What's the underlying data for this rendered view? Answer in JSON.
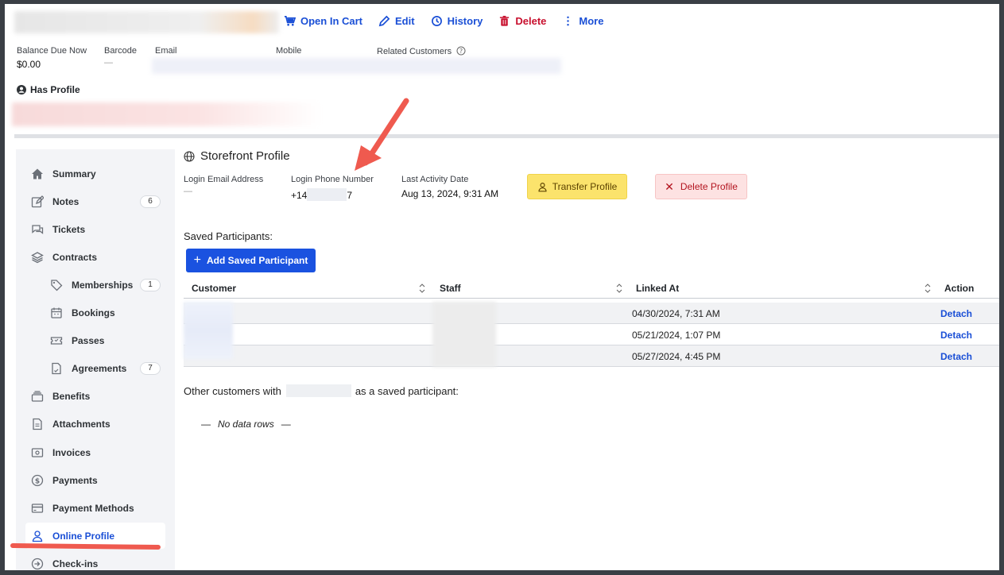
{
  "toolbar": {
    "open_in_cart": "Open In Cart",
    "edit": "Edit",
    "history": "History",
    "delete": "Delete",
    "more": "More"
  },
  "customer_meta": {
    "balance_label": "Balance Due Now",
    "balance_value": "$0.00",
    "barcode_label": "Barcode",
    "barcode_value": "—",
    "email_label": "Email",
    "mobile_label": "Mobile",
    "related_label": "Related Customers"
  },
  "has_profile": "Has Profile",
  "sidebar": {
    "items": [
      {
        "label": "Summary",
        "icon": "home-icon"
      },
      {
        "label": "Notes",
        "icon": "edit-note-icon",
        "badge": "6"
      },
      {
        "label": "Tickets",
        "icon": "chat-bubbles-icon"
      },
      {
        "label": "Contracts",
        "icon": "layers-icon"
      },
      {
        "label": "Memberships",
        "icon": "tag-icon",
        "badge": "1",
        "sub": true
      },
      {
        "label": "Bookings",
        "icon": "calendar-icon",
        "sub": true
      },
      {
        "label": "Passes",
        "icon": "ticket-icon",
        "sub": true
      },
      {
        "label": "Agreements",
        "icon": "document-icon",
        "badge": "7",
        "sub": true
      },
      {
        "label": "Benefits",
        "icon": "stack-icon"
      },
      {
        "label": "Attachments",
        "icon": "file-icon"
      },
      {
        "label": "Invoices",
        "icon": "invoice-icon"
      },
      {
        "label": "Payments",
        "icon": "dollar-circle-icon"
      },
      {
        "label": "Payment Methods",
        "icon": "credit-card-icon"
      },
      {
        "label": "Online Profile",
        "icon": "user-icon",
        "active": true
      },
      {
        "label": "Check-ins",
        "icon": "arrow-circle-icon"
      }
    ]
  },
  "storefront": {
    "title": "Storefront Profile",
    "login_email_label": "Login Email Address",
    "login_email_value": "—",
    "login_phone_label": "Login Phone Number",
    "login_phone_prefix": "+14",
    "login_phone_suffix": "7",
    "last_activity_label": "Last Activity Date",
    "last_activity_value": "Aug 13, 2024, 9:31 AM",
    "transfer_button": "Transfer Profile",
    "delete_button": "Delete Profile"
  },
  "saved_participants": {
    "label": "Saved Participants:",
    "add_button": "Add Saved Participant",
    "columns": [
      "Customer",
      "Staff",
      "Linked At",
      "Action"
    ],
    "rows": [
      {
        "linked_at": "04/30/2024, 7:31 AM",
        "action": "Detach"
      },
      {
        "linked_at": "05/21/2024, 1:07 PM",
        "action": "Detach"
      },
      {
        "linked_at": "05/27/2024, 4:45 PM",
        "action": "Detach"
      }
    ]
  },
  "other_customers": {
    "prefix": "Other customers with",
    "suffix": "as a saved participant:",
    "no_rows": "No data rows",
    "dash": "—"
  },
  "colors": {
    "accent": "#1a4fd6",
    "danger": "#c8102e",
    "transfer_bg": "#fbe36c",
    "delete_bg": "#fde2e2",
    "annotation": "#ef5a4f"
  }
}
